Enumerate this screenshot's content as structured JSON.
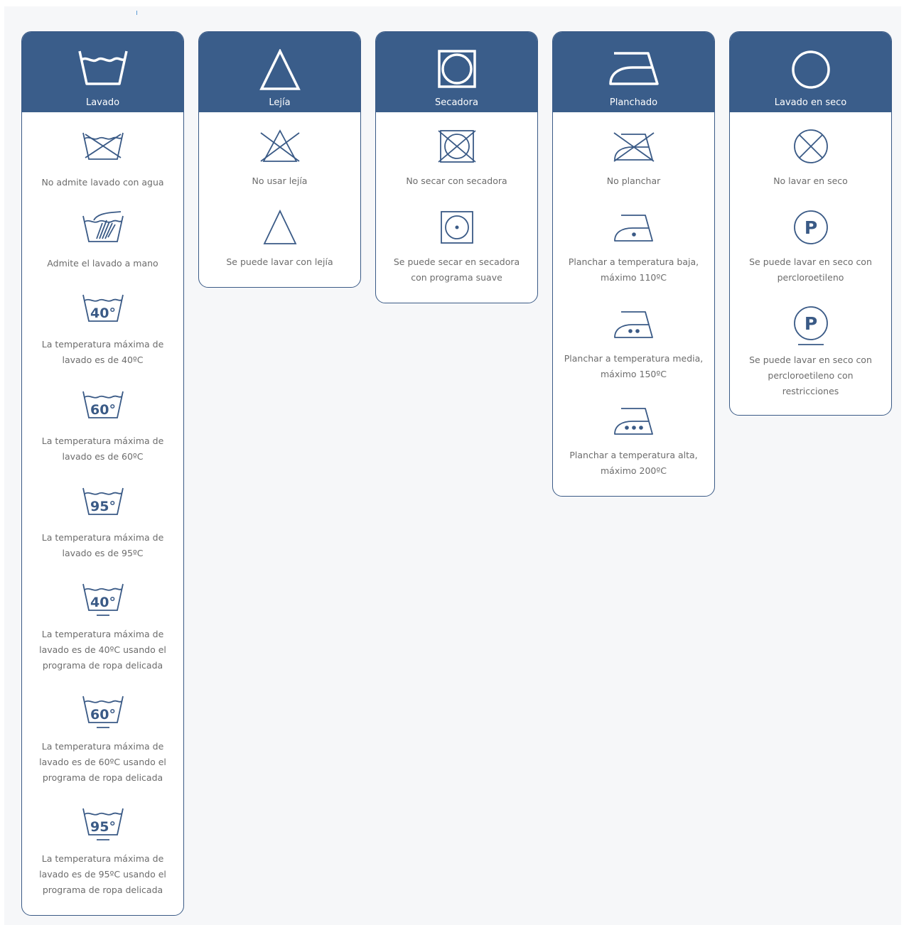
{
  "colors": {
    "header_bg": "#3a5d8a",
    "border": "#3a5a86",
    "icon_stroke": "#3a5a86",
    "label_text": "#6c6c6c",
    "page_bg": "#f6f7f9"
  },
  "columns": [
    {
      "title": "Lavado",
      "header_icon": "wash-tub-icon",
      "items": [
        {
          "icon": "no-wash-icon",
          "label": "No admite lavado con agua"
        },
        {
          "icon": "hand-wash-icon",
          "label": "Admite el lavado a mano"
        },
        {
          "icon": "wash-40-icon",
          "label": "La temperatura máxima de lavado es de 40ºC",
          "temp": "40°"
        },
        {
          "icon": "wash-60-icon",
          "label": "La temperatura máxima de lavado es de 60ºC",
          "temp": "60°"
        },
        {
          "icon": "wash-95-icon",
          "label": "La temperatura máxima de lavado es de 95ºC",
          "temp": "95°"
        },
        {
          "icon": "wash-40-delicate-icon",
          "label": "La temperatura máxima de lavado es de 40ºC usando el programa de ropa delicada",
          "temp": "40°"
        },
        {
          "icon": "wash-60-delicate-icon",
          "label": "La temperatura máxima de lavado es de 60ºC usando el programa de ropa delicada",
          "temp": "60°"
        },
        {
          "icon": "wash-95-delicate-icon",
          "label": "La temperatura máxima de lavado es de 95ºC usando el programa de ropa delicada",
          "temp": "95°"
        }
      ]
    },
    {
      "title": "Lejía",
      "header_icon": "triangle-icon",
      "items": [
        {
          "icon": "no-bleach-icon",
          "label": "No usar lejía"
        },
        {
          "icon": "bleach-icon",
          "label": "Se puede lavar con lejía"
        }
      ]
    },
    {
      "title": "Secadora",
      "header_icon": "tumble-dry-icon",
      "items": [
        {
          "icon": "no-tumble-dry-icon",
          "label": "No secar con secadora"
        },
        {
          "icon": "tumble-dry-low-icon",
          "label": "Se puede secar en secadora con programa suave"
        }
      ]
    },
    {
      "title": "Planchado",
      "header_icon": "iron-icon",
      "items": [
        {
          "icon": "no-iron-icon",
          "label": "No planchar"
        },
        {
          "icon": "iron-low-icon",
          "label": "Planchar a temperatura baja, máximo 110ºC"
        },
        {
          "icon": "iron-medium-icon",
          "label": "Planchar a temperatura media, máximo 150ºC"
        },
        {
          "icon": "iron-high-icon",
          "label": "Planchar a temperatura alta, máximo 200ºC"
        }
      ]
    },
    {
      "title": "Lavado en seco",
      "header_icon": "circle-icon",
      "items": [
        {
          "icon": "no-dry-clean-icon",
          "label": "No lavar en seco"
        },
        {
          "icon": "dry-clean-p-icon",
          "label": "Se puede lavar en seco con percloroetileno",
          "letter": "P"
        },
        {
          "icon": "dry-clean-p-gentle-icon",
          "label": "Se puede lavar en seco con percloroetileno con restricciones",
          "letter": "P"
        }
      ]
    }
  ]
}
